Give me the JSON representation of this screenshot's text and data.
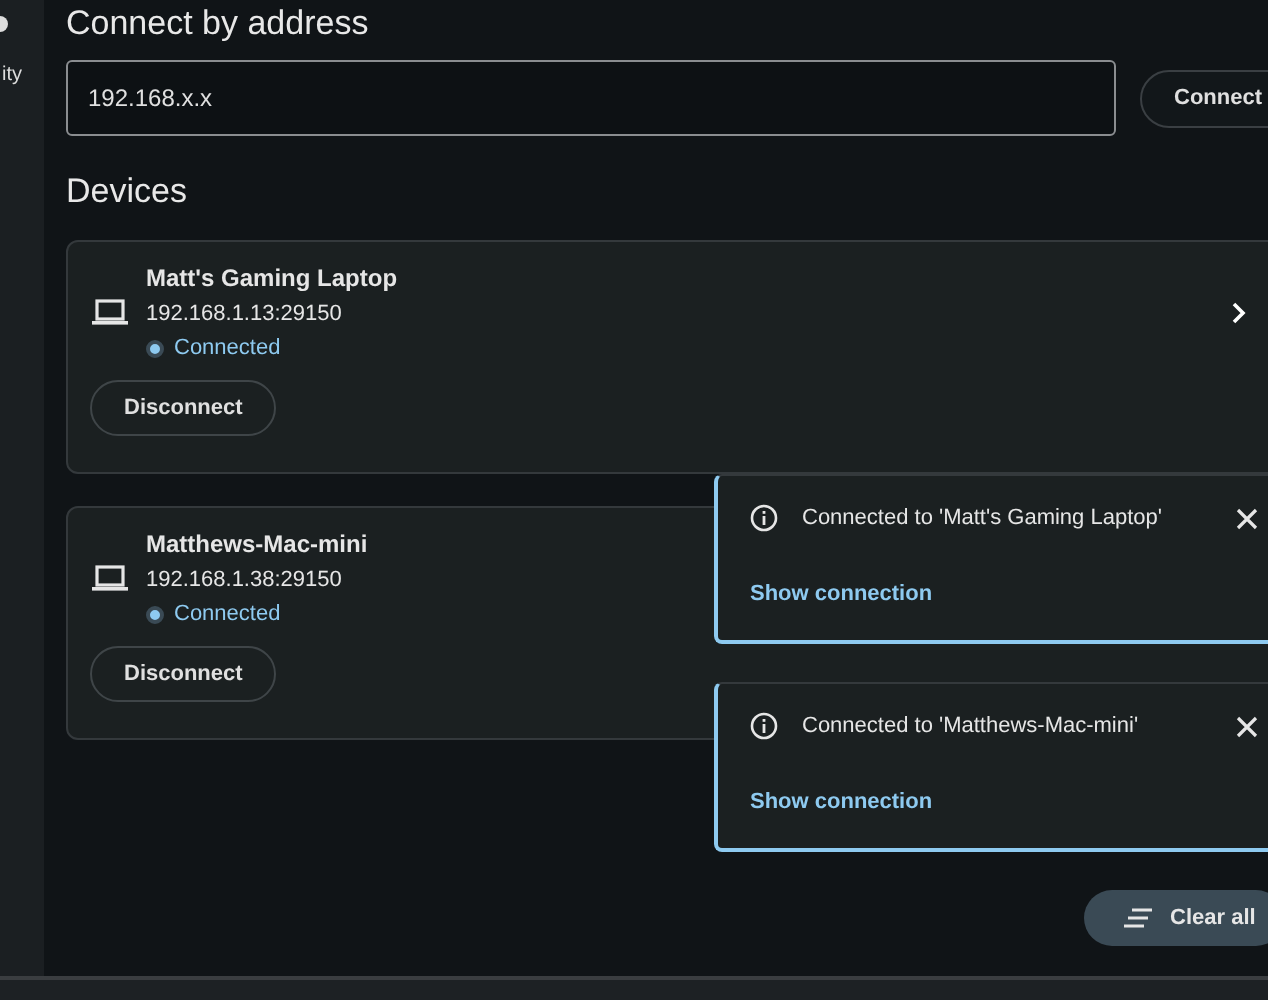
{
  "sidebar": {
    "items": [
      {
        "label": "ity"
      }
    ]
  },
  "connect": {
    "title": "Connect by address",
    "field": {
      "value": "192.168.x.x"
    },
    "button": "Connect"
  },
  "devices": {
    "title": "Devices",
    "items": [
      {
        "name": "Matt's Gaming Laptop",
        "address": "192.168.1.13:29150",
        "status": "Connected",
        "connected": true,
        "button": "Disconnect",
        "chevron": true
      },
      {
        "name": "Matthews-Mac-mini",
        "address": "192.168.1.38:29150",
        "status": "Connected",
        "connected": true,
        "button": "Disconnect",
        "chevron": false
      }
    ]
  },
  "notifications": [
    {
      "message": "Connected to 'Matt's Gaming Laptop'",
      "link": "Show connection"
    },
    {
      "message": "Connected to 'Matthews-Mac-mini'",
      "link": "Show connection"
    }
  ],
  "clear_all": "Clear all"
}
